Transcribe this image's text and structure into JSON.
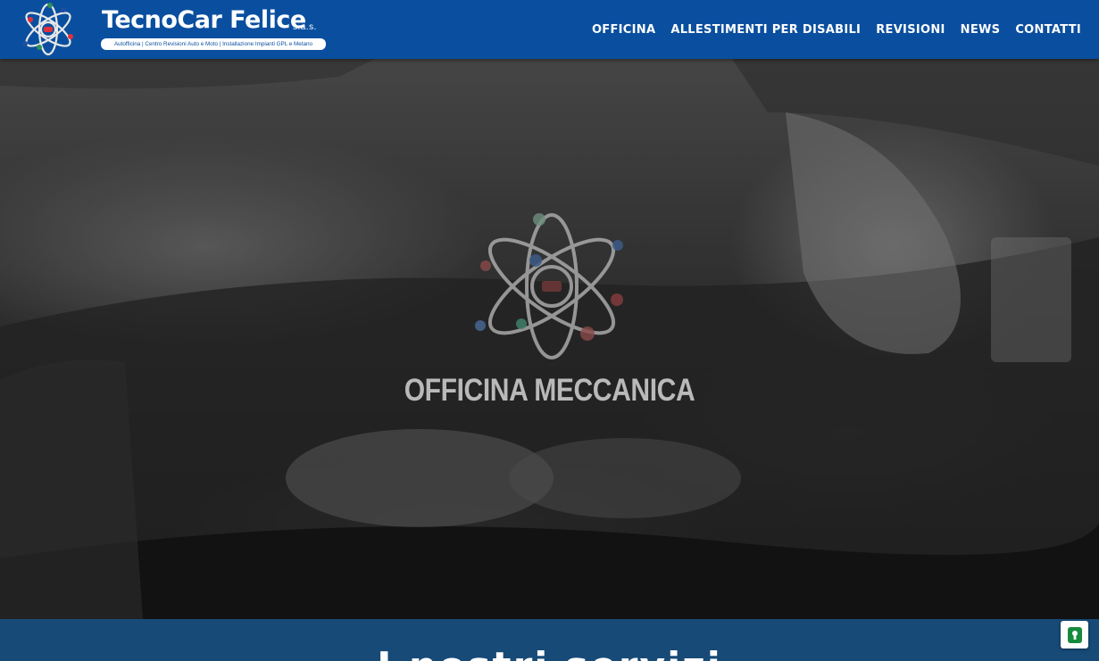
{
  "header": {
    "brand_name": "TecnoCar Felice",
    "brand_suffix": "s.a.s.",
    "tagline": "Autofficina | Centro Revisioni Auto e Moto | Installazione Impianti GPL e Metano"
  },
  "nav": {
    "items": [
      {
        "label": "OFFICINA"
      },
      {
        "label": "ALLESTIMENTI PER DISABILI"
      },
      {
        "label": "REVISIONI"
      },
      {
        "label": "NEWS"
      },
      {
        "label": "CONTATTI"
      }
    ]
  },
  "hero": {
    "title": "OFFICINA MECCANICA",
    "background_image": "car-engine-mechanic-photo",
    "emblem_icon": "atom-logo-icon"
  },
  "section": {
    "heading": "I nostri servizi"
  },
  "colors": {
    "header_bg": "#0a4f9f",
    "section_bar_bg": "#174a77",
    "logo_red": "#e0313b",
    "logo_blue": "#1d4fa3",
    "logo_green": "#2f8f5a"
  },
  "cookie_button": {
    "icon": "keyhole-icon"
  }
}
